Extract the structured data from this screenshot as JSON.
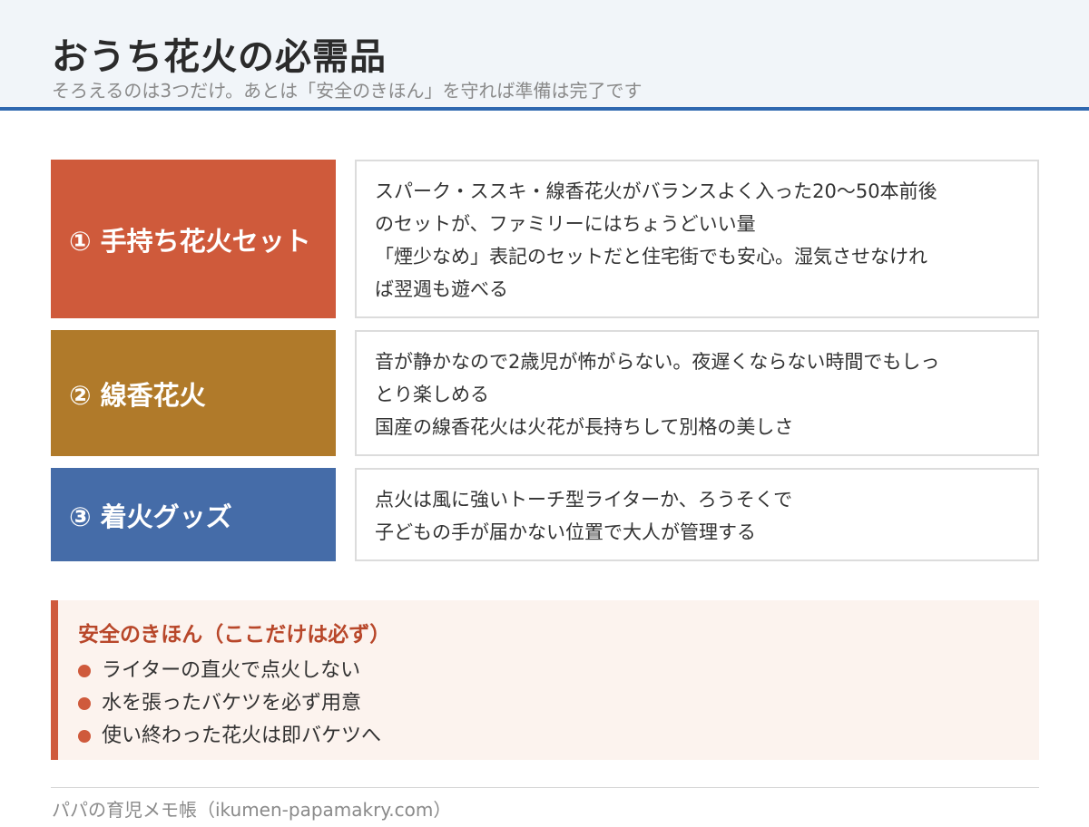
{
  "header": {
    "title": "おうち花火の必需品",
    "subtitle": "そろえるのは3つだけ。あとは「安全のきほん」を守れば準備は完了です"
  },
  "items": [
    {
      "label": "① 手持ち花火セット",
      "color": "#cf5a3b",
      "lines": [
        "スパーク・ススキ・線香花火がバランスよく入った20〜50本前後",
        "のセットが、ファミリーにはちょうどいい量",
        "「煙少なめ」表記のセットだと住宅街でも安心。湿気させなけれ",
        "ば翌週も遊べる"
      ]
    },
    {
      "label": "② 線香花火",
      "color": "#b07a2a",
      "lines": [
        "音が静かなので2歳児が怖がらない。夜遅くならない時間でもしっ",
        "とり楽しめる",
        "国産の線香花火は火花が長持ちして別格の美しさ"
      ]
    },
    {
      "label": "③ 着火グッズ",
      "color": "#456ca8",
      "lines": [
        "点火は風に強いトーチ型ライターか、ろうそくで",
        "子どもの手が届かない位置で大人が管理する"
      ]
    }
  ],
  "safety": {
    "title": "安全のきほん（ここだけは必ず）",
    "accent_color": "#cf5a3c",
    "items": [
      "ライターの直火で点火しない",
      "水を張ったバケツを必ず用意",
      "使い終わった花火は即バケツへ"
    ]
  },
  "footer": {
    "text": "パパの育児メモ帳（ikumen-papamakry.com）"
  }
}
